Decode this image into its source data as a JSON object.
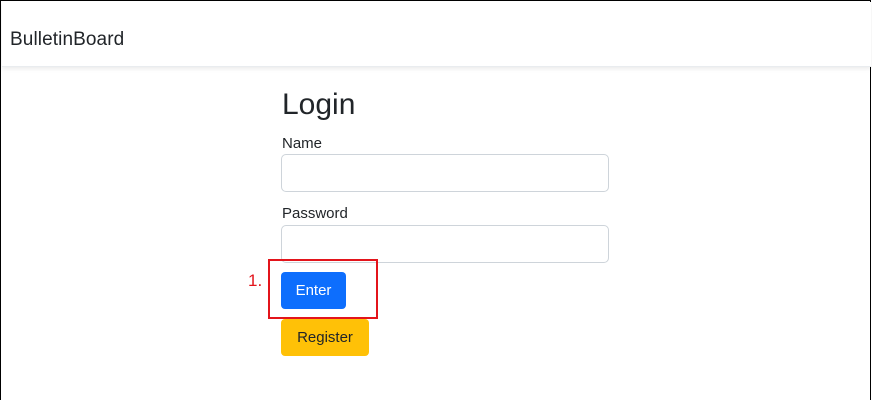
{
  "navbar": {
    "brand": "BulletinBoard"
  },
  "login": {
    "title": "Login",
    "name_label": "Name",
    "name_value": "",
    "password_label": "Password",
    "password_value": "",
    "enter_label": "Enter",
    "register_label": "Register"
  },
  "annotation": {
    "step_label": "1.",
    "color": "#e3141b"
  },
  "colors": {
    "primary": "#0d6efd",
    "warning": "#ffc107"
  }
}
